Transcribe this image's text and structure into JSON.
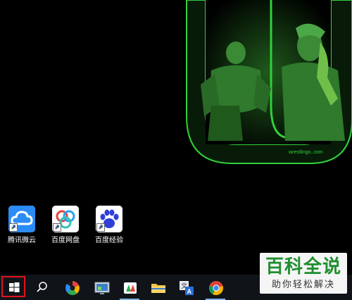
{
  "desktop": {
    "icons": [
      {
        "label": "腾讯微云",
        "icon": "weiyun-cloud-icon"
      },
      {
        "label": "百度网盘",
        "icon": "baidu-netdisk-icon"
      },
      {
        "label": "百度经验",
        "icon": "baidu-paw-icon"
      }
    ],
    "wallpaper": {
      "watermark_text": "wrestlingo..com",
      "accent_color": "#2fd13a"
    }
  },
  "overlay": {
    "title": "百科全说",
    "subtitle": "助你轻松解决",
    "title_color": "#1e8f2e"
  },
  "taskbar": {
    "items": [
      {
        "name": "start",
        "icon": "windows-logo-icon",
        "highlighted": true
      },
      {
        "name": "search",
        "icon": "search-icon"
      },
      {
        "name": "app-colorful",
        "icon": "colorful-pinwheel-icon"
      },
      {
        "name": "app-monitor",
        "icon": "monitor-app-icon"
      },
      {
        "name": "app-cards",
        "icon": "cards-app-icon"
      },
      {
        "name": "file-explorer",
        "icon": "folder-icon"
      },
      {
        "name": "translator",
        "icon": "translate-icon"
      },
      {
        "name": "chrome",
        "icon": "chrome-icon"
      }
    ],
    "highlight_color": "#e0121b"
  }
}
